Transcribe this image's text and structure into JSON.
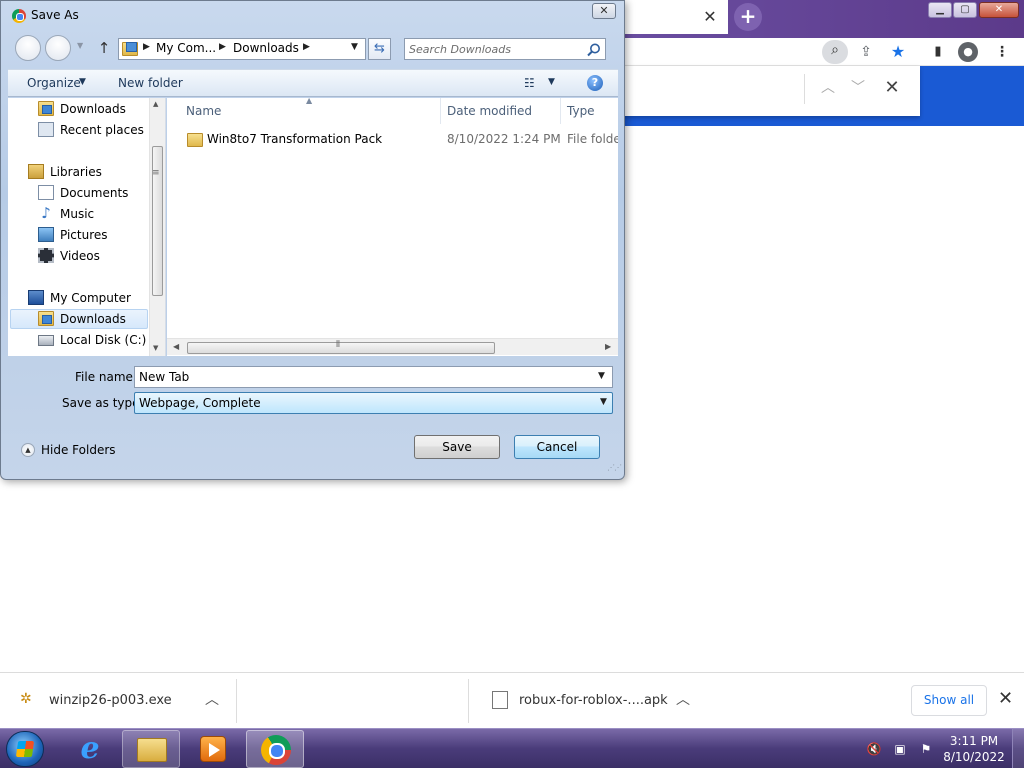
{
  "dialog": {
    "title": "Save As",
    "close_glyph": "✕",
    "address": {
      "crumbs": [
        "My Com...",
        "Downloads"
      ]
    },
    "search_placeholder": "Search Downloads",
    "commands": {
      "organize": "Organize",
      "new_folder": "New folder"
    },
    "nav_pane": {
      "items": [
        {
          "label": "Downloads",
          "icon": "downloads-folder-icon"
        },
        {
          "label": "Recent places",
          "icon": "recent-places-icon"
        },
        {
          "label": "Libraries",
          "icon": "libraries-icon"
        },
        {
          "label": "Documents",
          "icon": "documents-icon"
        },
        {
          "label": "Music",
          "icon": "music-icon"
        },
        {
          "label": "Pictures",
          "icon": "pictures-icon"
        },
        {
          "label": "Videos",
          "icon": "videos-icon"
        },
        {
          "label": "My Computer",
          "icon": "computer-icon"
        },
        {
          "label": "Downloads",
          "icon": "downloads-folder-icon",
          "selected": true
        },
        {
          "label": "Local Disk (C:)",
          "icon": "disk-icon"
        }
      ]
    },
    "file_list": {
      "columns": [
        "Name",
        "Date modified",
        "Type"
      ],
      "rows": [
        {
          "name": "Win8to7 Transformation Pack",
          "date_modified": "8/10/2022 1:24 PM",
          "type": "File folder"
        }
      ]
    },
    "file_name_label": "File name:",
    "file_name_value": "New Tab",
    "save_as_type_label": "Save as type:",
    "save_as_type_value": "Webpage, Complete",
    "hide_folders": "Hide Folders",
    "save_button": "Save",
    "cancel_button": "Cancel"
  },
  "browser": {
    "tab_close": "✕",
    "new_tab": "+",
    "find_bar": {
      "close": "✕"
    }
  },
  "downloads": {
    "items": [
      {
        "name": "winzip26-p003.exe"
      },
      {
        "name": "robux-for-roblox-....apk"
      }
    ],
    "show_all": "Show all",
    "close": "✕"
  },
  "taskbar": {
    "clock_time": "3:11 PM",
    "clock_date": "8/10/2022"
  },
  "colors": {
    "accent_blue": "#1a5ad4",
    "chrome_frame": "#5b3f8e",
    "link_blue": "#1a73e8"
  }
}
